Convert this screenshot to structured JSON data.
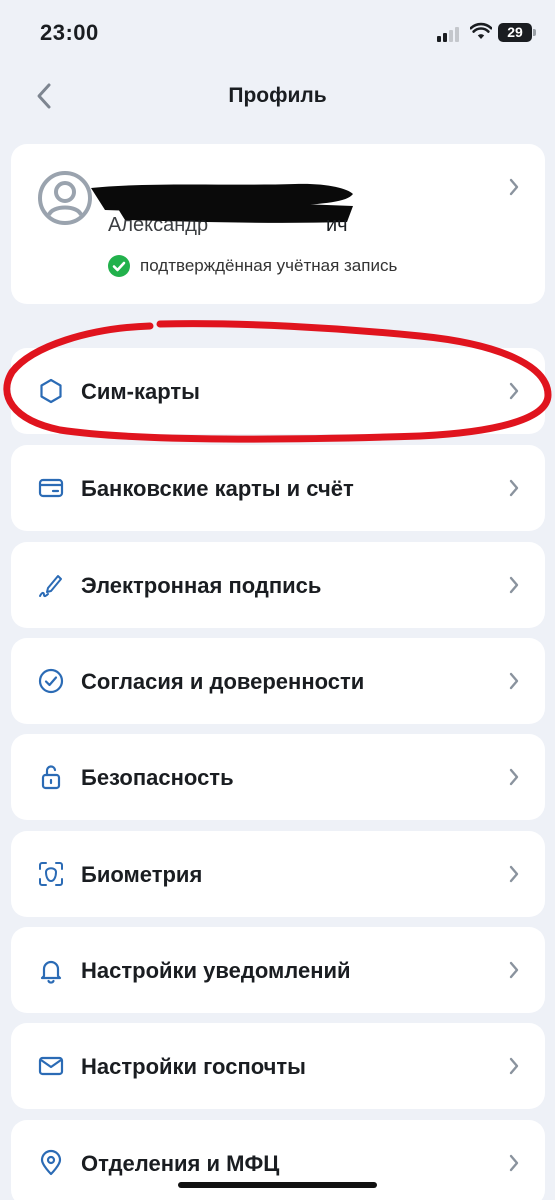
{
  "status_bar": {
    "time": "23:00",
    "battery": "29",
    "icons": [
      "signal-icon",
      "wifi-icon",
      "battery-icon"
    ]
  },
  "header": {
    "title": "Профиль",
    "back_icon": "chevron-left-icon"
  },
  "profile": {
    "name_visible_fragment": "Александр",
    "patronymic_fragment": "ич",
    "verified_text": "подтверждённая учётная запись",
    "avatar_icon": "user-avatar-icon",
    "verified_icon": "check-circle-icon"
  },
  "colors": {
    "accent": "#2b6bb5",
    "verified_green": "#22b14c",
    "background": "#eef1f7",
    "card": "#ffffff",
    "annotation_red": "#e0141e"
  },
  "menu": [
    {
      "id": "sim-cards",
      "label": "Сим-карты",
      "icon": "hexagon-icon"
    },
    {
      "id": "bank-cards",
      "label": "Банковские карты и счёт",
      "icon": "bank-card-icon"
    },
    {
      "id": "e-signature",
      "label": "Электронная подпись",
      "icon": "pen-signature-icon"
    },
    {
      "id": "consents",
      "label": "Согласия и доверенности",
      "icon": "check-circle-icon"
    },
    {
      "id": "security",
      "label": "Безопасность",
      "icon": "lock-icon"
    },
    {
      "id": "biometrics",
      "label": "Биометрия",
      "icon": "face-scan-icon"
    },
    {
      "id": "notifications",
      "label": "Настройки уведомлений",
      "icon": "bell-icon"
    },
    {
      "id": "gosmail",
      "label": "Настройки госпочты",
      "icon": "envelope-icon"
    },
    {
      "id": "offices",
      "label": "Отделения и МФЦ",
      "icon": "location-pin-icon"
    }
  ]
}
